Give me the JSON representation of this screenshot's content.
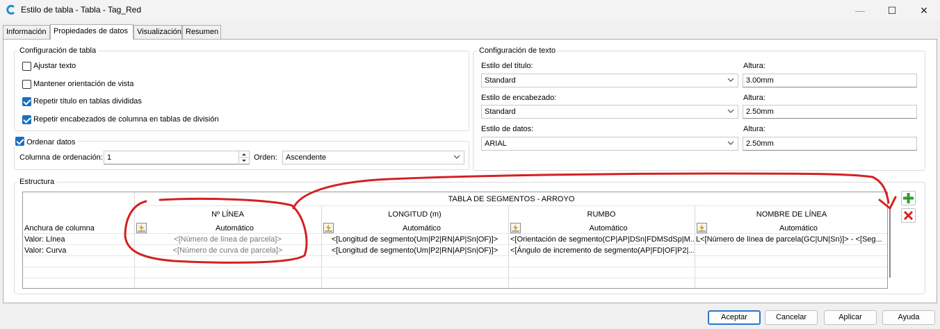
{
  "window": {
    "title": "Estilo de tabla - Tabla - Tag_Red",
    "min_glyph": "—",
    "max_glyph": "☐",
    "close_glyph": "✕",
    "icon": "civil3d-c-icon"
  },
  "tabs": [
    {
      "label": "Información"
    },
    {
      "label": "Propiedades de datos"
    },
    {
      "label": "Visualización"
    },
    {
      "label": "Resumen"
    }
  ],
  "config_tabla": {
    "legend": "Configuración de tabla",
    "options": [
      {
        "label": "Ajustar texto",
        "checked": false
      },
      {
        "label": "Mantener orientación de vista",
        "checked": false
      },
      {
        "label": "Repetir título en tablas divididas",
        "checked": true
      },
      {
        "label": "Repetir encabezados de columna en tablas de división",
        "checked": true
      }
    ]
  },
  "ordenar": {
    "legend": "Ordenar datos",
    "checked": true,
    "column_label": "Columna de ordenación:",
    "column_value": "1",
    "order_label": "Orden:",
    "order_value": "Ascendente"
  },
  "config_texto": {
    "legend": "Configuración de texto",
    "rows": [
      {
        "style_label": "Estilo del título:",
        "style_value": "Standard",
        "height_label": "Altura:",
        "height_value": "3.00mm"
      },
      {
        "style_label": "Estilo de encabezado:",
        "style_value": "Standard",
        "height_label": "Altura:",
        "height_value": "2.50mm"
      },
      {
        "style_label": "Estilo de datos:",
        "style_value": "ARIAL",
        "height_label": "Altura:",
        "height_value": "2.50mm"
      }
    ]
  },
  "estructura": {
    "legend": "Estructura",
    "table_title": "TABLA DE SEGMENTOS - ARROYO",
    "row_labels": [
      "Anchura de columna",
      "Valor: Línea",
      "Valor: Curva"
    ],
    "columns": [
      {
        "header": "Nº LÍNEA",
        "width": "Automático",
        "linea": "<[Número de línea de parcela]>",
        "curva": "<[Número de curva de parcela]>"
      },
      {
        "header": "LONGITUD (m)",
        "width": "Automático",
        "linea": "<[Longitud de segmento(Um|P2|RN|AP|Sn|OF)]>",
        "curva": "<[Longitud de segmento(Um|P2|RN|AP|Sn|OF)]>"
      },
      {
        "header": "RUMBO",
        "width": "Automático",
        "linea": "<[Orientación de segmento(CP|AP|DSn|FDMSdSp|M...",
        "curva": "<[Ángulo de incremento de segmento(AP|FD|OF|P2|..."
      },
      {
        "header": "NOMBRE DE LÍNEA",
        "width": "Automático",
        "linea": "L<[Número de línea de parcela(GC|UN|Sn)]> - <[Seg...",
        "curva": ""
      }
    ],
    "add_icon": "green-plus-icon",
    "delete_icon": "red-x-icon"
  },
  "buttons": {
    "accept": "Aceptar",
    "cancel": "Cancelar",
    "apply": "Aplicar",
    "help": "Ayuda"
  },
  "colors": {
    "accent": "#1a6fc4",
    "annotation": "#d42020",
    "add": "#2e9e2e",
    "delete": "#d42020"
  }
}
